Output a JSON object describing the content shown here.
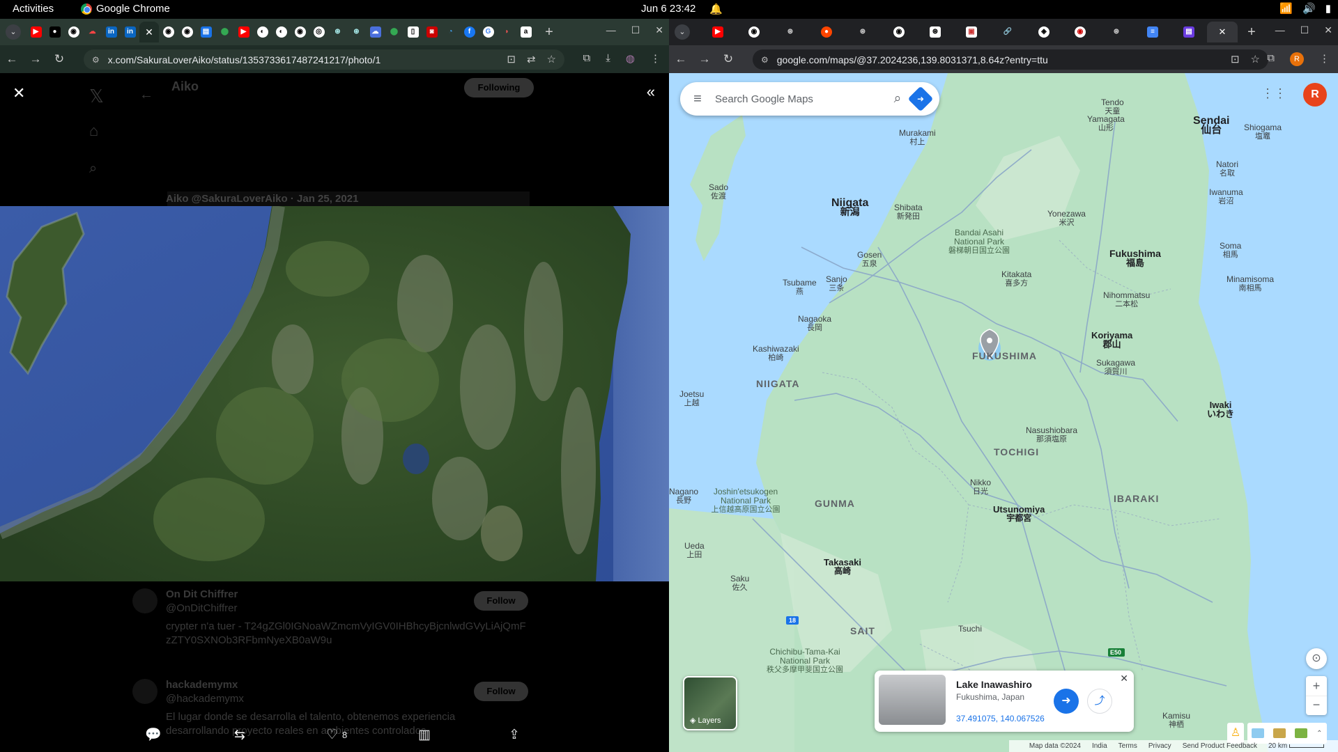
{
  "topbar": {
    "activities": "Activities",
    "app_name": "Google Chrome",
    "clock": "Jun 6  23:42"
  },
  "left_window": {
    "url": "x.com/SakuraLoverAiko/status/1353733617487241217/photo/1",
    "tab_icons": [
      "youtube-icon",
      "medium-icon",
      "github-icon",
      "cloud-icon",
      "linkedin-icon",
      "linkedin-icon"
    ],
    "tab_icons_after": [
      "github-icon",
      "github-icon",
      "table-icon",
      "maps-icon",
      "youtube-icon",
      "medium-icon",
      "medium-icon",
      "github-icon",
      "globe-icon",
      "openai-icon",
      "openai-icon",
      "app-icon",
      "docs-icon",
      "app-icon",
      "app-icon",
      "app-icon",
      "facebook-icon",
      "google-icon",
      "app-icon",
      "app-icon"
    ],
    "ghost_name": "Aiko",
    "ghost_following": "Following",
    "ghost_handle_line": "Aiko @SakuraLoverAiko · Jan 25, 2021",
    "ghost_user1_name": "On Dit Chiffrer",
    "ghost_user1_handle": "@OnDitChiffrer",
    "ghost_user1_text": "crypter n'a tuer - T24gZGl0IGNoaWZmcmVyIGV0IHBhcyBjcnlwdGVyLiAjQmFzZTY0SXNOb3RFbmNyeXB0aW9u",
    "ghost_user2_name": "hackademymx",
    "ghost_user2_handle": "@hackademymx",
    "ghost_user2_text": "El lugar donde se desarrolla el talento, obtenemos experiencia desarrollando proyecto reales en ambientes controlados",
    "ghost_follow": "Follow",
    "like_count": "8"
  },
  "right_window": {
    "url": "google.com/maps/@37.2024236,139.8031371,8.64z?entry=ttu",
    "profile_initial": "R",
    "search_placeholder": "Search Google Maps",
    "layers_label": "Layers",
    "place": {
      "title": "Lake Inawashiro",
      "subtitle": "Fukushima, Japan",
      "coords": "37.491075, 140.067526"
    },
    "footer": [
      "Map data ©2024",
      "India",
      "Terms",
      "Privacy",
      "Send Product Feedback",
      "20 km"
    ],
    "labels": {
      "murakami": "Murakami",
      "murakami_kj": "村上",
      "tendo": "Tendo",
      "tendo_kj": "天童",
      "yamagata": "Yamagata",
      "yamagata_kj": "山形",
      "sendai": "Sendai",
      "sendai_kj": "仙台",
      "shiogama": "Shiogama",
      "shiogama_kj": "塩竈",
      "natori": "Natori",
      "natori_kj": "名取",
      "iwanuma": "Iwanuma",
      "iwanuma_kj": "岩沼",
      "sado": "Sado",
      "sado_kj": "佐渡",
      "niigata": "Niigata",
      "niigata_kj": "新潟",
      "shibata": "Shibata",
      "shibata_kj": "新発田",
      "bandai": "Bandai Asahi National Park",
      "bandai_kj": "磐梯朝日国立公園",
      "yonezawa": "Yonezawa",
      "yonezawa_kj": "米沢",
      "fukushima_city": "Fukushima",
      "fukushima_city_kj": "福島",
      "soma": "Soma",
      "soma_kj": "相馬",
      "minamisoma": "Minamisoma",
      "minamisoma_kj": "南相馬",
      "gosen": "Gosen",
      "gosen_kj": "五泉",
      "tsubame": "Tsubame",
      "tsubame_kj": "燕",
      "sanjo": "Sanjo",
      "sanjo_kj": "三条",
      "kitakata": "Kitakata",
      "kitakata_kj": "喜多方",
      "nihonmatsu": "Nihommatsu",
      "nihonmatsu_kj": "二本松",
      "nagaoka": "Nagaoka",
      "nagaoka_kj": "長岡",
      "koriyama": "Koriyama",
      "koriyama_kj": "郡山",
      "kashiwazaki": "Kashiwazaki",
      "kashiwazaki_kj": "柏崎",
      "fukushima_pref": "FUKUSHIMA",
      "sukagawa": "Sukagawa",
      "sukagawa_kj": "須賀川",
      "niigata_pref": "NIIGATA",
      "joetsu": "Joetsu",
      "joetsu_kj": "上越",
      "iwaki": "Iwaki",
      "iwaki_kj": "いわき",
      "nasushiobara": "Nasushiobara",
      "nasushiobara_kj": "那須塩原",
      "tochigi_pref": "TOCHIGI",
      "nikko": "Nikko",
      "nikko_kj": "日光",
      "nagano": "Nagano",
      "nagano_kj": "長野",
      "joshin": "Joshin'etsukogen National Park",
      "joshin_kj": "上信越高原国立公園",
      "gunma_pref": "GUNMA",
      "ibaraki_pref": "IBARAKI",
      "utsunomiya": "Utsunomiya",
      "utsunomiya_kj": "宇都宮",
      "ueda": "Ueda",
      "ueda_kj": "上田",
      "takasaki": "Takasaki",
      "takasaki_kj": "高崎",
      "saku": "Saku",
      "saku_kj": "佐久",
      "saitama_partial": "SAIT",
      "chichibu": "Chichibu-Tama-Kai National Park",
      "chichibu_kj": "秩父多摩甲斐国立公園",
      "kamisu": "Kamisu",
      "kamisu_kj": "神栖",
      "tsuchiura_partial": "Tsuchi",
      "route18": "18",
      "e50": "E50"
    }
  }
}
